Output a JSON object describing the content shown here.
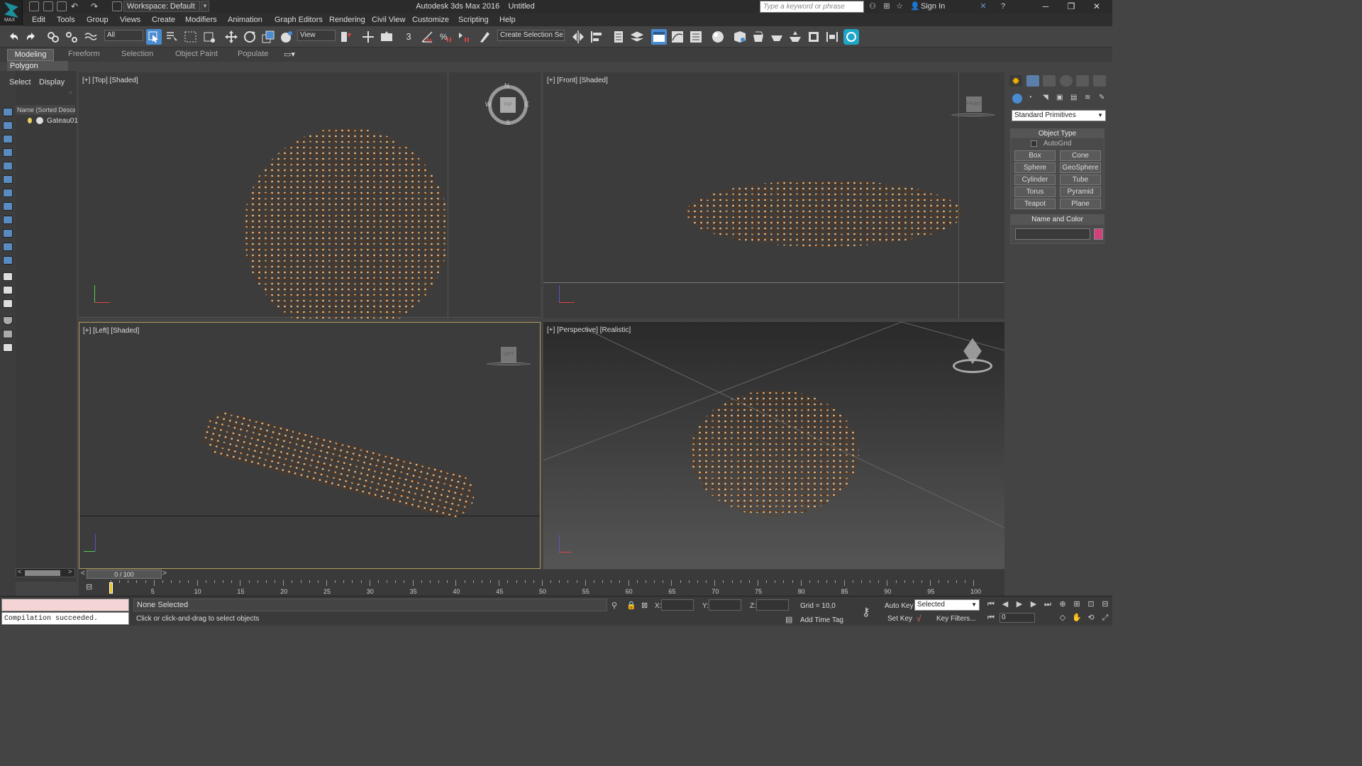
{
  "titlebar": {
    "logo_text": "MAX",
    "workspace": "Workspace: Default",
    "app_title": "Autodesk 3ds Max 2016",
    "doc_title": "Untitled",
    "search_placeholder": "Type a keyword or phrase",
    "sign_in": "Sign In"
  },
  "menu": [
    "Edit",
    "Tools",
    "Group",
    "Views",
    "Create",
    "Modifiers",
    "Animation",
    "Graph Editors",
    "Rendering",
    "Civil View",
    "Customize",
    "Scripting",
    "Help"
  ],
  "toolbar": {
    "filter": "All",
    "ref_coord": "View",
    "selection_set": "Create Selection Se",
    "snap_label": "3"
  },
  "ribbon": {
    "tabs": [
      "Modeling",
      "Freeform",
      "Selection",
      "Object Paint",
      "Populate"
    ],
    "sub": "Polygon Modeling"
  },
  "explorer": {
    "tab_select": "Select",
    "tab_display": "Display",
    "header": "Name (Sorted Descen",
    "items": [
      "Gateau01"
    ]
  },
  "viewports": {
    "top": "[+] [Top] [Shaded]",
    "front": "[+] [Front] [Shaded]",
    "left": "[+] [Left] [Shaded]",
    "persp": "[+] [Perspective] [Realistic]",
    "compass": [
      "N",
      "W",
      "E",
      "S"
    ],
    "cube_top": "TOP",
    "cube_front": "FRONT",
    "cube_left": "LEFT"
  },
  "command_panel": {
    "category": "Standard Primitives",
    "object_type": "Object Type",
    "autogrid": "AutoGrid",
    "buttons": [
      "Box",
      "Cone",
      "Sphere",
      "GeoSphere",
      "Cylinder",
      "Tube",
      "Torus",
      "Pyramid",
      "Teapot",
      "Plane"
    ],
    "name_color": "Name and Color",
    "object_color": "#d0407a"
  },
  "timeline": {
    "slider": "0 / 100",
    "ticks": [
      "5",
      "10",
      "15",
      "20",
      "25",
      "30",
      "35",
      "40",
      "45",
      "50",
      "55",
      "60",
      "65",
      "70",
      "75",
      "80",
      "85",
      "90",
      "95",
      "100"
    ]
  },
  "status": {
    "compile": "Compilation succeeded.",
    "selection": "None Selected",
    "prompt": "Click or click-and-drag to select objects",
    "x_label": "X:",
    "y_label": "Y:",
    "z_label": "Z:",
    "grid": "Grid = 10,0",
    "add_time_tag": "Add Time Tag",
    "auto_key": "Auto Key",
    "set_key": "Set Key",
    "selected": "Selected",
    "key_filters": "Key Filters...",
    "frame": "0"
  },
  "colors": {
    "accent": "#4a8bd1",
    "active_viewport": "#b09a58"
  }
}
